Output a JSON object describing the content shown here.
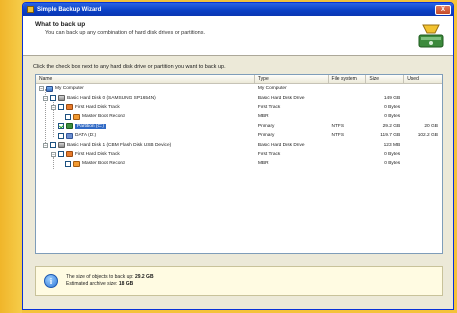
{
  "window": {
    "title": "Simple Backup Wizard",
    "close_label": "X"
  },
  "header": {
    "title": "What to back up",
    "subtitle": "You can back up any combination of hard disk drives or partitions."
  },
  "instruction": "Click the check box next to any hard disk drive or partition you want to back up.",
  "columns": {
    "name": "Name",
    "type": "Type",
    "fs": "File system",
    "size": "Size",
    "used": "Used"
  },
  "rows": [
    {
      "name": "My Computer",
      "type": "My Computer",
      "fs": "",
      "size": "",
      "used": "",
      "icon": "computer-icon"
    },
    {
      "name": "Basic Hard Disk 0 (SAMSUNG SP1654N)",
      "type": "Basic Hard Disk Drive",
      "fs": "",
      "size": "149 GB",
      "used": "",
      "icon": "hard-disk-icon"
    },
    {
      "name": "First Hard Disk Track",
      "type": "First Track",
      "fs": "",
      "size": "0 Bytes",
      "used": "",
      "icon": "disk-track-icon"
    },
    {
      "name": "Master Boot Record",
      "type": "MBR",
      "fs": "",
      "size": "0 Bytes",
      "used": "",
      "icon": "mbr-icon"
    },
    {
      "name": "Partition (C:)",
      "type": "Primary",
      "fs": "NTFS",
      "size": "29.2 GB",
      "used": "20 GB",
      "icon": "partition-icon"
    },
    {
      "name": "DATA (D:)",
      "type": "Primary",
      "fs": "NTFS",
      "size": "119.7 GB",
      "used": "102.2 GB",
      "icon": "data-partition-icon"
    },
    {
      "name": "Basic Hard Disk 1 (CBM Flash Disk USB Device)",
      "type": "Basic Hard Disk Drive",
      "fs": "",
      "size": "123 MB",
      "used": "",
      "icon": "hard-disk-icon"
    },
    {
      "name": "First Hard Disk Track",
      "type": "First Track",
      "fs": "",
      "size": "0 Bytes",
      "used": "",
      "icon": "disk-track-icon"
    },
    {
      "name": "Master Boot Record",
      "type": "MBR",
      "fs": "",
      "size": "0 Bytes",
      "used": "",
      "icon": "mbr-icon"
    }
  ],
  "status": {
    "line1_label": "The size of objects to back up:",
    "line1_value": "29.2 GB",
    "line2_label": "Estimated archive size:",
    "line2_value": "18 GB"
  }
}
